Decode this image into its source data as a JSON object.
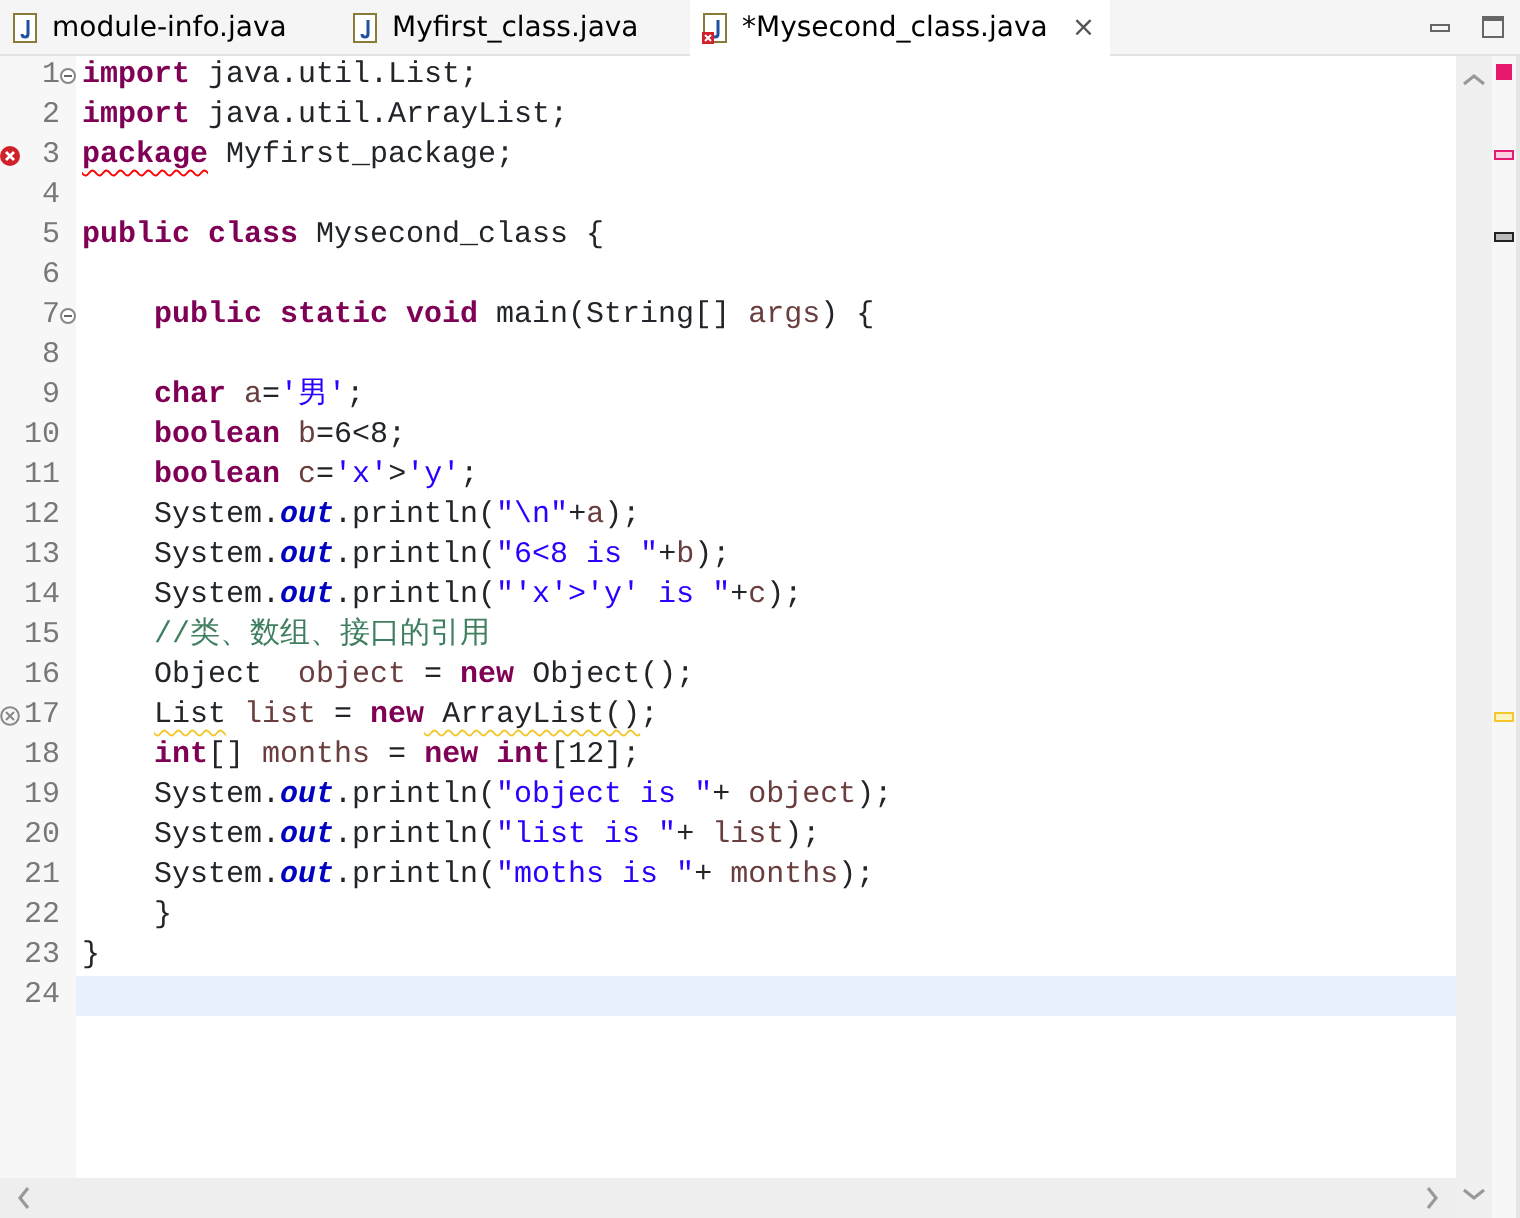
{
  "tabs": [
    {
      "label": "module-info.java",
      "selected": false,
      "error": false
    },
    {
      "label": "Myfirst_class.java",
      "selected": false,
      "error": false
    },
    {
      "label": "*Mysecond_class.java",
      "selected": true,
      "error": true,
      "close": "×"
    }
  ],
  "lines": [
    {
      "number": "1",
      "fold": true,
      "tokens": [
        {
          "kind": "keyword",
          "text": "import"
        },
        {
          "kind": "plain",
          "text": " java.util.List;"
        }
      ]
    },
    {
      "number": "2",
      "tokens": [
        {
          "kind": "keyword",
          "text": "import"
        },
        {
          "kind": "plain",
          "text": " java.util.ArrayList;"
        }
      ]
    },
    {
      "number": "3",
      "error": true,
      "tokens": [
        {
          "kind": "keyword",
          "text": "package",
          "error_underline": true
        },
        {
          "kind": "plain",
          "text": " Myfirst_package;"
        }
      ]
    },
    {
      "number": "4"
    },
    {
      "number": "5",
      "tokens": [
        {
          "kind": "keyword",
          "text": "public class"
        },
        {
          "kind": "plain",
          "text": " Mysecond_class {"
        }
      ]
    },
    {
      "number": "6"
    },
    {
      "number": "7",
      "fold": true,
      "indent": true,
      "tokens": [
        {
          "kind": "keyword",
          "text": "public static void"
        },
        {
          "kind": "plain",
          "text": " main(String[]"
        },
        {
          "kind": "variable",
          "text": " args"
        },
        {
          "kind": "plain",
          "text": ") {"
        }
      ]
    },
    {
      "number": "8"
    },
    {
      "number": "9",
      "indent": true,
      "tokens": [
        {
          "kind": "keyword",
          "text": "char"
        },
        {
          "kind": "variable",
          "text": " a"
        },
        {
          "kind": "plain",
          "text": "="
        },
        {
          "kind": "string",
          "text": "'男'"
        },
        {
          "kind": "plain",
          "text": ";"
        }
      ]
    },
    {
      "number": "10",
      "indent": true,
      "tokens": [
        {
          "kind": "keyword",
          "text": "boolean"
        },
        {
          "kind": "variable",
          "text": " b"
        },
        {
          "kind": "plain",
          "text": "=6<8;"
        }
      ]
    },
    {
      "number": "11",
      "indent": true,
      "tokens": [
        {
          "kind": "keyword",
          "text": "boolean"
        },
        {
          "kind": "variable",
          "text": " c"
        },
        {
          "kind": "plain",
          "text": "="
        },
        {
          "kind": "string",
          "text": "'x'"
        },
        {
          "kind": "plain",
          "text": ">"
        },
        {
          "kind": "string",
          "text": "'y'"
        },
        {
          "kind": "plain",
          "text": ";"
        }
      ]
    },
    {
      "number": "12",
      "indent": true,
      "tokens": [
        {
          "kind": "plain",
          "text": "System."
        },
        {
          "kind": "field",
          "text": "out"
        },
        {
          "kind": "plain",
          "text": ".println("
        },
        {
          "kind": "string",
          "text": "\"\\n\""
        },
        {
          "kind": "plain",
          "text": "+"
        },
        {
          "kind": "variable",
          "text": "a"
        },
        {
          "kind": "plain",
          "text": ");"
        }
      ]
    },
    {
      "number": "13",
      "indent": true,
      "tokens": [
        {
          "kind": "plain",
          "text": "System."
        },
        {
          "kind": "field",
          "text": "out"
        },
        {
          "kind": "plain",
          "text": ".println("
        },
        {
          "kind": "string",
          "text": "\"6<8 is \""
        },
        {
          "kind": "plain",
          "text": "+"
        },
        {
          "kind": "variable",
          "text": "b"
        },
        {
          "kind": "plain",
          "text": ");"
        }
      ]
    },
    {
      "number": "14",
      "indent": true,
      "tokens": [
        {
          "kind": "plain",
          "text": "System."
        },
        {
          "kind": "field",
          "text": "out"
        },
        {
          "kind": "plain",
          "text": ".println("
        },
        {
          "kind": "string",
          "text": "\"'x'>'y' is \""
        },
        {
          "kind": "plain",
          "text": "+"
        },
        {
          "kind": "variable",
          "text": "c"
        },
        {
          "kind": "plain",
          "text": ");"
        }
      ]
    },
    {
      "number": "15",
      "indent": true,
      "tokens": [
        {
          "kind": "comment",
          "text": "//类、数组、接口的引用"
        }
      ]
    },
    {
      "number": "16",
      "indent": true,
      "tokens": [
        {
          "kind": "plain",
          "text": "Object"
        },
        {
          "kind": "variable",
          "text": "  object"
        },
        {
          "kind": "plain",
          "text": " = "
        },
        {
          "kind": "keyword",
          "text": "new"
        },
        {
          "kind": "plain",
          "text": " Object();"
        }
      ]
    },
    {
      "number": "17",
      "warning": true,
      "indent": true,
      "tokens": [
        {
          "kind": "plain",
          "text": "List",
          "warning_underline": true
        },
        {
          "kind": "variable",
          "text": " list"
        },
        {
          "kind": "plain",
          "text": " = "
        },
        {
          "kind": "keyword",
          "text": "new"
        },
        {
          "kind": "plain",
          "text": " ArrayList()",
          "warning_underline": true
        },
        {
          "kind": "plain",
          "text": ";"
        }
      ]
    },
    {
      "number": "18",
      "indent": true,
      "tokens": [
        {
          "kind": "keyword",
          "text": "int"
        },
        {
          "kind": "plain",
          "text": "[]"
        },
        {
          "kind": "variable",
          "text": " months"
        },
        {
          "kind": "plain",
          "text": " = "
        },
        {
          "kind": "keyword",
          "text": "new int"
        },
        {
          "kind": "plain",
          "text": "[12];"
        }
      ]
    },
    {
      "number": "19",
      "indent": true,
      "tokens": [
        {
          "kind": "plain",
          "text": "System."
        },
        {
          "kind": "field",
          "text": "out"
        },
        {
          "kind": "plain",
          "text": ".println("
        },
        {
          "kind": "string",
          "text": "\"object is \""
        },
        {
          "kind": "plain",
          "text": "+"
        },
        {
          "kind": "variable",
          "text": " object"
        },
        {
          "kind": "plain",
          "text": ");"
        }
      ]
    },
    {
      "number": "20",
      "indent": true,
      "tokens": [
        {
          "kind": "plain",
          "text": "System."
        },
        {
          "kind": "field",
          "text": "out"
        },
        {
          "kind": "plain",
          "text": ".println("
        },
        {
          "kind": "string",
          "text": "\"list is \""
        },
        {
          "kind": "plain",
          "text": "+"
        },
        {
          "kind": "variable",
          "text": " list"
        },
        {
          "kind": "plain",
          "text": ");"
        }
      ]
    },
    {
      "number": "21",
      "indent": true,
      "tokens": [
        {
          "kind": "plain",
          "text": "System."
        },
        {
          "kind": "field",
          "text": "out"
        },
        {
          "kind": "plain",
          "text": ".println("
        },
        {
          "kind": "string",
          "text": "\"moths is \""
        },
        {
          "kind": "plain",
          "text": "+"
        },
        {
          "kind": "variable",
          "text": " months"
        },
        {
          "kind": "plain",
          "text": ");"
        }
      ]
    },
    {
      "number": "22",
      "indent": true,
      "tokens": [
        {
          "kind": "plain",
          "text": "}"
        }
      ]
    },
    {
      "number": "23",
      "tokens": [
        {
          "kind": "plain",
          "text": "}"
        }
      ]
    },
    {
      "number": "24",
      "current": true
    }
  ]
}
